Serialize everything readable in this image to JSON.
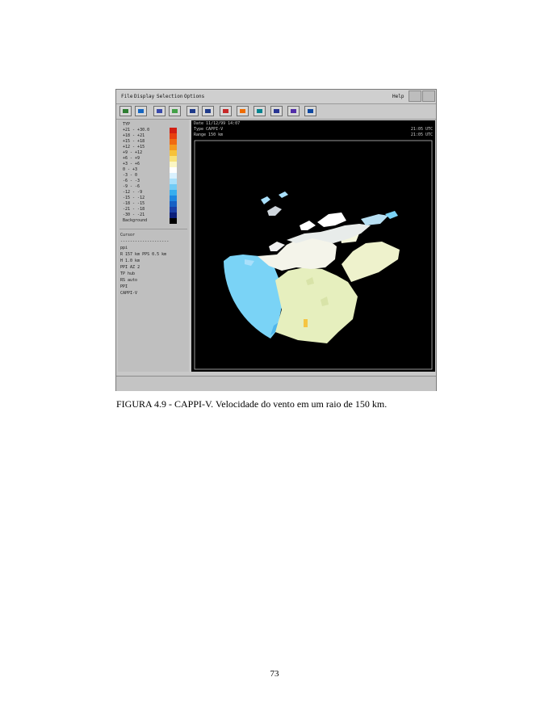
{
  "figure": {
    "menubar": {
      "items": [
        "File",
        "Display",
        "Selection",
        "Options"
      ],
      "help": "Help"
    },
    "legend": {
      "entries": [
        {
          "label": "TYP",
          "color": ""
        },
        {
          "label": "+21 - +30.0",
          "color": "#d21e12"
        },
        {
          "label": "+18 - +21",
          "color": "#e8410f"
        },
        {
          "label": "+15 - +18",
          "color": "#f06a12"
        },
        {
          "label": "+12 - +15",
          "color": "#f59a1e"
        },
        {
          "label": "+9 - +12",
          "color": "#f7c23a"
        },
        {
          "label": "+6 - +9",
          "color": "#f8e27a"
        },
        {
          "label": "+3 - +6",
          "color": "#fbf6c4"
        },
        {
          "label": "0 - +3",
          "color": "#ffffff"
        },
        {
          "label": "-3 - 0",
          "color": "#d9f1ff"
        },
        {
          "label": "-6 - -3",
          "color": "#a9e0fb"
        },
        {
          "label": "-9 - -6",
          "color": "#71cbf5"
        },
        {
          "label": "-12 - -9",
          "color": "#38aeee"
        },
        {
          "label": "-15 - -12",
          "color": "#1e86e0"
        },
        {
          "label": "-18 - -15",
          "color": "#1760c4"
        },
        {
          "label": "-21 - -18",
          "color": "#1a3fa6"
        },
        {
          "label": "-30 - -21",
          "color": "#0c1f7a"
        },
        {
          "label": "Background",
          "color": "#000000"
        }
      ],
      "info_lines": [
        "Cursor",
        "--------------------",
        "ppi",
        "R 157 km PPS 0.5 km",
        "H 1.0 km",
        "PPI AZ 2",
        "TP hub",
        "RS auto",
        "PPI",
        "CAPPI-V"
      ]
    },
    "header": {
      "lines": [
        "Date 11/12/99 14:07",
        "Type CAPPI-V",
        "Range 150 km"
      ],
      "right_lines": [
        "21:05 UTC",
        "21:05 UTC"
      ]
    }
  },
  "caption": "FIGURA 4.9 - CAPPI-V. Velocidade do vento em um raio de 150 km.",
  "page_number": "73"
}
